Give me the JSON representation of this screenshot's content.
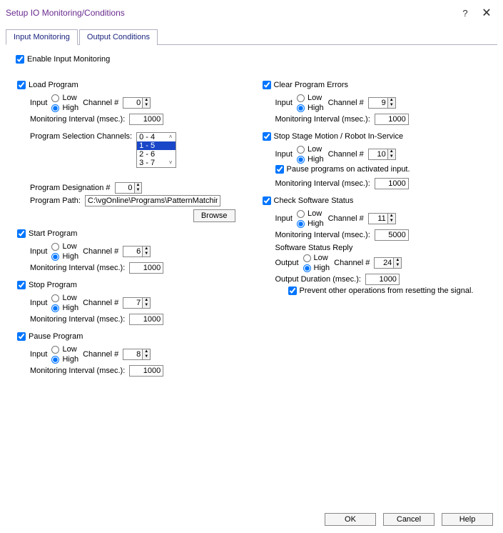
{
  "window": {
    "title": "Setup IO Monitoring/Conditions",
    "help": "?",
    "close": "🗙"
  },
  "tabs": {
    "input": "Input Monitoring",
    "output": "Output Conditions"
  },
  "enable_label": "Enable Input Monitoring",
  "common": {
    "low": "Low",
    "high": "High",
    "input": "Input",
    "output": "Output",
    "channel": "Channel #",
    "moninterval": "Monitoring Interval (msec.):",
    "outputduration": "Output Duration (msec.):",
    "browse": "Browse"
  },
  "load": {
    "title": "Load Program",
    "ch": "0",
    "interval": "1000",
    "psc_label": "Program Selection Channels:",
    "psc": [
      "0 - 4",
      "1 - 5",
      "2 - 6",
      "3 - 7"
    ],
    "pdesig_label": "Program Designation #",
    "pdesig": "0",
    "ppath_label": "Program Path:",
    "ppath": "C:\\vgOnline\\Programs\\PatternMatchin"
  },
  "start": {
    "title": "Start Program",
    "ch": "6",
    "interval": "1000"
  },
  "stop": {
    "title": "Stop Program",
    "ch": "7",
    "interval": "1000"
  },
  "pause": {
    "title": "Pause Program",
    "ch": "8",
    "interval": "1000"
  },
  "clear": {
    "title": "Clear Program Errors",
    "ch": "9",
    "interval": "1000"
  },
  "stage": {
    "title": "Stop Stage Motion / Robot In-Service",
    "ch": "10",
    "interval": "1000",
    "pause_label": "Pause programs on activated input."
  },
  "swstatus": {
    "title": "Check Software Status",
    "ch": "11",
    "interval": "5000",
    "reply_title": "Software Status Reply",
    "out_ch": "24",
    "out_dur": "1000",
    "prevent_label": "Prevent other operations from resetting the signal."
  },
  "footer": {
    "ok": "OK",
    "cancel": "Cancel",
    "help": "Help"
  }
}
